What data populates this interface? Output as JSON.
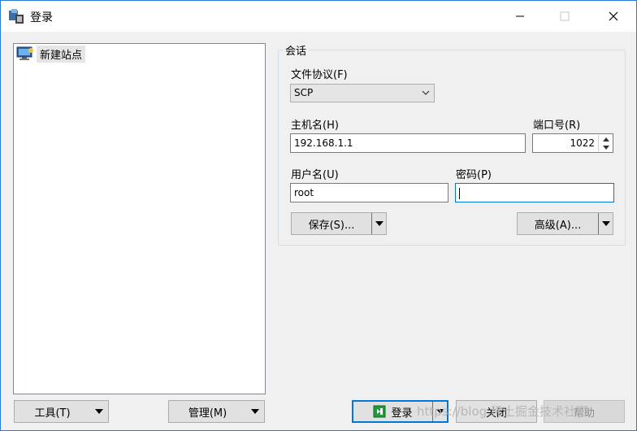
{
  "window": {
    "title": "登录"
  },
  "sites": [
    {
      "label": "新建站点"
    }
  ],
  "session": {
    "group_title": "会话",
    "protocol_label": "文件协议(F)",
    "protocol_value": "SCP",
    "host_label": "主机名(H)",
    "host_value": "192.168.1.1",
    "port_label": "端口号(R)",
    "port_value": "1022",
    "user_label": "用户名(U)",
    "user_value": "root",
    "password_label": "密码(P)",
    "password_value": "",
    "save_button": "保存(S)...",
    "advanced_button": "高级(A)..."
  },
  "footer": {
    "tools_button": "工具(T)",
    "manage_button": "管理(M)",
    "login_button": "登录",
    "close_button": "关闭",
    "help_button": "帮助"
  },
  "watermark": "https://blog.稀土掘金技术社区",
  "colors": {
    "accent": "#0078d7",
    "login_icon": "#1e9c3a"
  }
}
